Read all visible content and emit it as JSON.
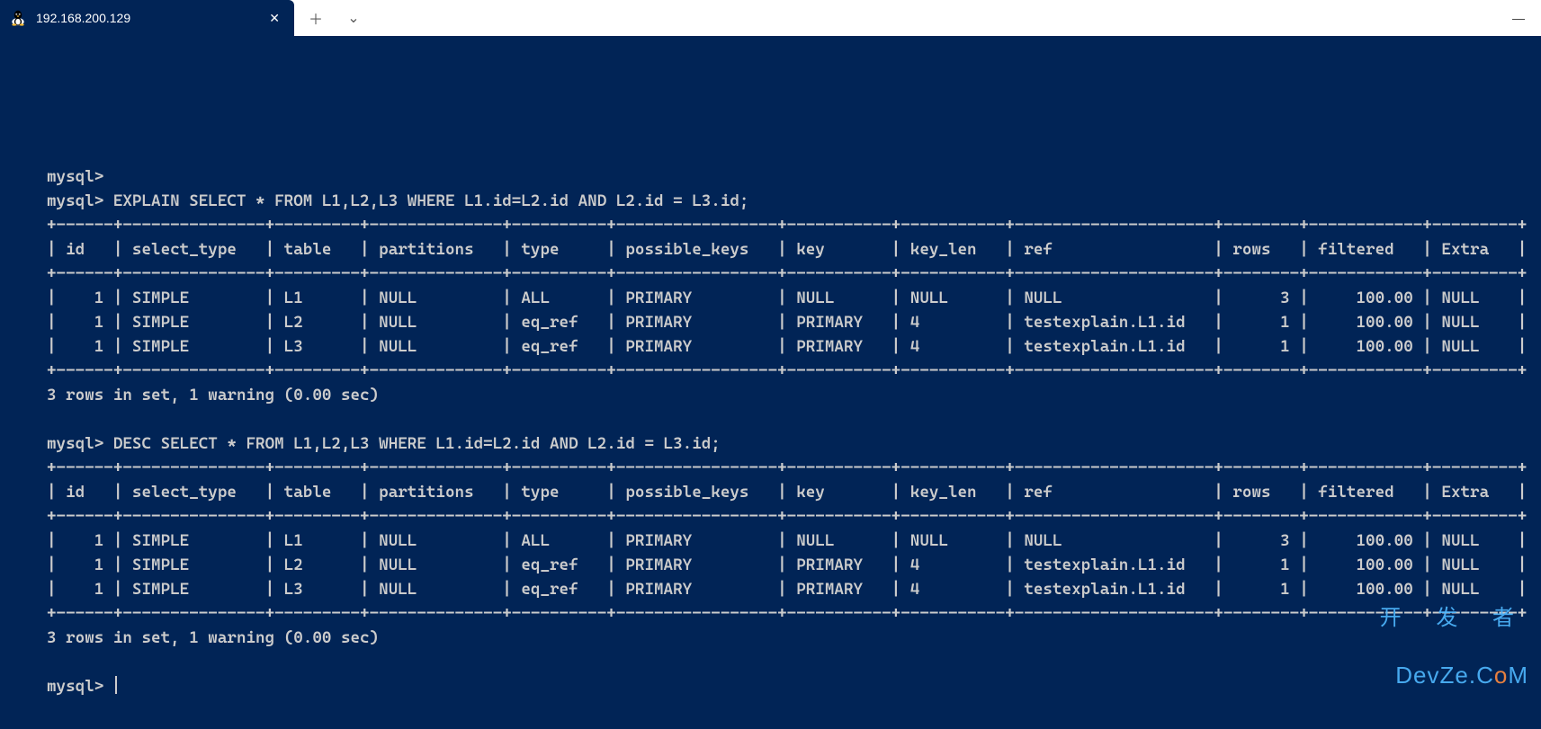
{
  "titlebar": {
    "tab_title": "192.168.200.129",
    "tab_icon": "tux-icon",
    "close_glyph": "✕",
    "new_tab_glyph": "＋",
    "dropdown_glyph": "⌄",
    "minimize_glyph": "—"
  },
  "terminal": {
    "prompt": "mysql>",
    "query1": "EXPLAIN SELECT * FROM L1,L2,L3 WHERE L1.id=L2.id AND L2.id = L3.id;",
    "query2": "DESC SELECT * FROM L1,L2,L3 WHERE L1.id=L2.id AND L2.id = L3.id;",
    "result_footer": "3 rows in set, 1 warning (0.00 sec)",
    "table": {
      "headers": [
        "id",
        "select_type",
        "table",
        "partitions",
        "type",
        "possible_keys",
        "key",
        "key_len",
        "ref",
        "rows",
        "filtered",
        "Extra"
      ],
      "rows": [
        {
          "id": "1",
          "select_type": "SIMPLE",
          "table": "L1",
          "partitions": "NULL",
          "type": "ALL",
          "possible_keys": "PRIMARY",
          "key": "NULL",
          "key_len": "NULL",
          "ref": "NULL",
          "rows": "3",
          "filtered": "100.00",
          "Extra": "NULL"
        },
        {
          "id": "1",
          "select_type": "SIMPLE",
          "table": "L2",
          "partitions": "NULL",
          "type": "eq_ref",
          "possible_keys": "PRIMARY",
          "key": "PRIMARY",
          "key_len": "4",
          "ref": "testexplain.L1.id",
          "rows": "1",
          "filtered": "100.00",
          "Extra": "NULL"
        },
        {
          "id": "1",
          "select_type": "SIMPLE",
          "table": "L3",
          "partitions": "NULL",
          "type": "eq_ref",
          "possible_keys": "PRIMARY",
          "key": "PRIMARY",
          "key_len": "4",
          "ref": "testexplain.L1.id",
          "rows": "1",
          "filtered": "100.00",
          "Extra": "NULL"
        }
      ]
    }
  },
  "watermark": {
    "line1": "开 发 者",
    "line2_pre": "DevZe.C",
    "line2_o": "o",
    "line2_post": "M"
  },
  "col_widths": {
    "id": 4,
    "select_type": 13,
    "table": 7,
    "partitions": 12,
    "type": 8,
    "possible_keys": 15,
    "key": 9,
    "key_len": 9,
    "ref": 19,
    "rows": 6,
    "filtered": 10,
    "Extra": 7
  }
}
